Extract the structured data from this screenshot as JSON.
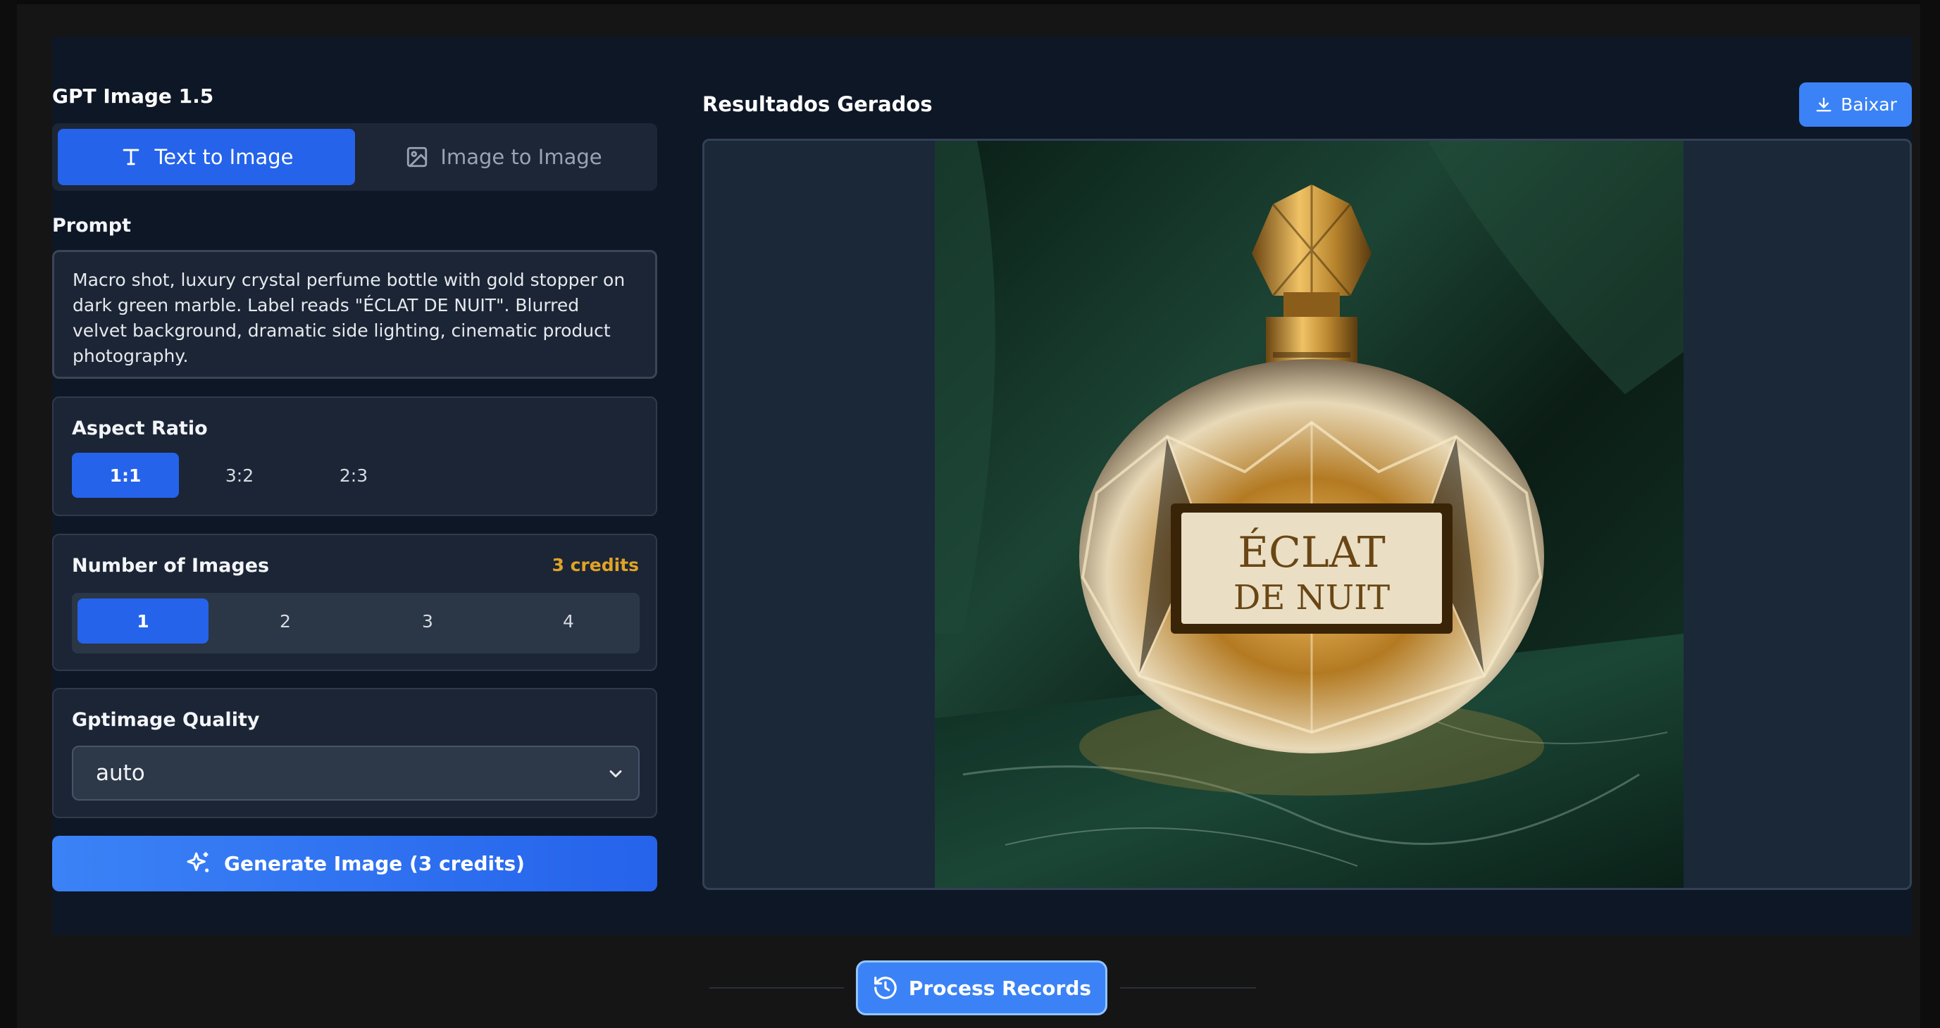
{
  "app": {
    "title": "GPT Image 1.5"
  },
  "mode_tabs": [
    {
      "label": "Text to Image",
      "icon": "text-icon",
      "active": true
    },
    {
      "label": "Image to Image",
      "icon": "image-icon",
      "active": false
    }
  ],
  "prompt": {
    "label": "Prompt",
    "value": "Macro shot, luxury crystal perfume bottle with gold stopper on dark green marble. Label reads \"ÉCLAT DE NUIT\". Blurred velvet background, dramatic side lighting, cinematic product photography."
  },
  "aspect_ratio": {
    "label": "Aspect Ratio",
    "options": [
      "1:1",
      "3:2",
      "2:3"
    ],
    "selected": "1:1"
  },
  "num_images": {
    "label": "Number of Images",
    "credits": "3 credits",
    "options": [
      "1",
      "2",
      "3",
      "4"
    ],
    "selected": "1"
  },
  "quality": {
    "label": "Gptimage Quality",
    "value": "auto"
  },
  "generate": {
    "label": "Generate Image (3 credits)",
    "icon": "sparkles-icon"
  },
  "results": {
    "title": "Resultados Gerados",
    "download_label": "Baixar",
    "image_label_line1": "ÉCLAT",
    "image_label_line2": "DE NUIT"
  },
  "records": {
    "label": "Process Records",
    "icon": "history-icon"
  },
  "colors": {
    "accent": "#2563eb",
    "accent_light": "#3b82f6",
    "panel_bg": "#0e1726",
    "card_bg": "#1b2535",
    "credits": "#e0a326"
  }
}
